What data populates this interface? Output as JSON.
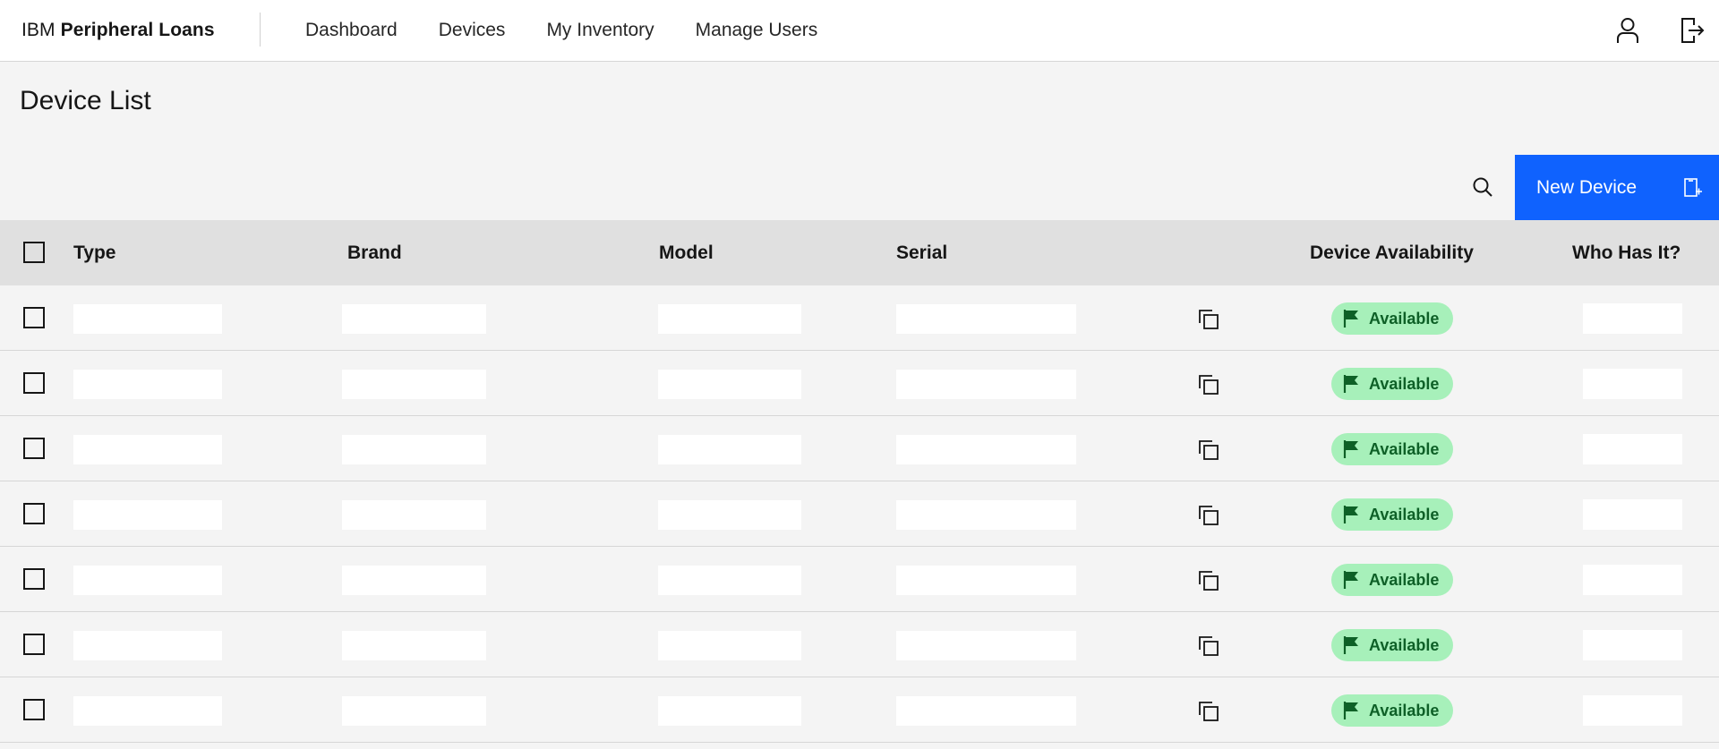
{
  "header": {
    "brand_prefix": "IBM",
    "brand_name": "Peripheral Loans",
    "nav": [
      "Dashboard",
      "Devices",
      "My Inventory",
      "Manage Users"
    ],
    "actions": [
      "user-icon",
      "logout-icon"
    ]
  },
  "page": {
    "title": "Device List"
  },
  "toolbar": {
    "search_icon": "search-icon",
    "new_device_label": "New Device",
    "new_device_icon": "add-device-icon",
    "accent_color": "#0f62fe"
  },
  "table": {
    "columns": [
      "Type",
      "Brand",
      "Model",
      "Serial",
      "Device Availability",
      "Who Has It?"
    ],
    "rows": [
      {
        "availability": "Available"
      },
      {
        "availability": "Available"
      },
      {
        "availability": "Available"
      },
      {
        "availability": "Available"
      },
      {
        "availability": "Available"
      },
      {
        "availability": "Available"
      },
      {
        "availability": "Available"
      }
    ],
    "status_colors": {
      "available_bg": "#a7f0ba",
      "available_text": "#0e6027"
    }
  }
}
